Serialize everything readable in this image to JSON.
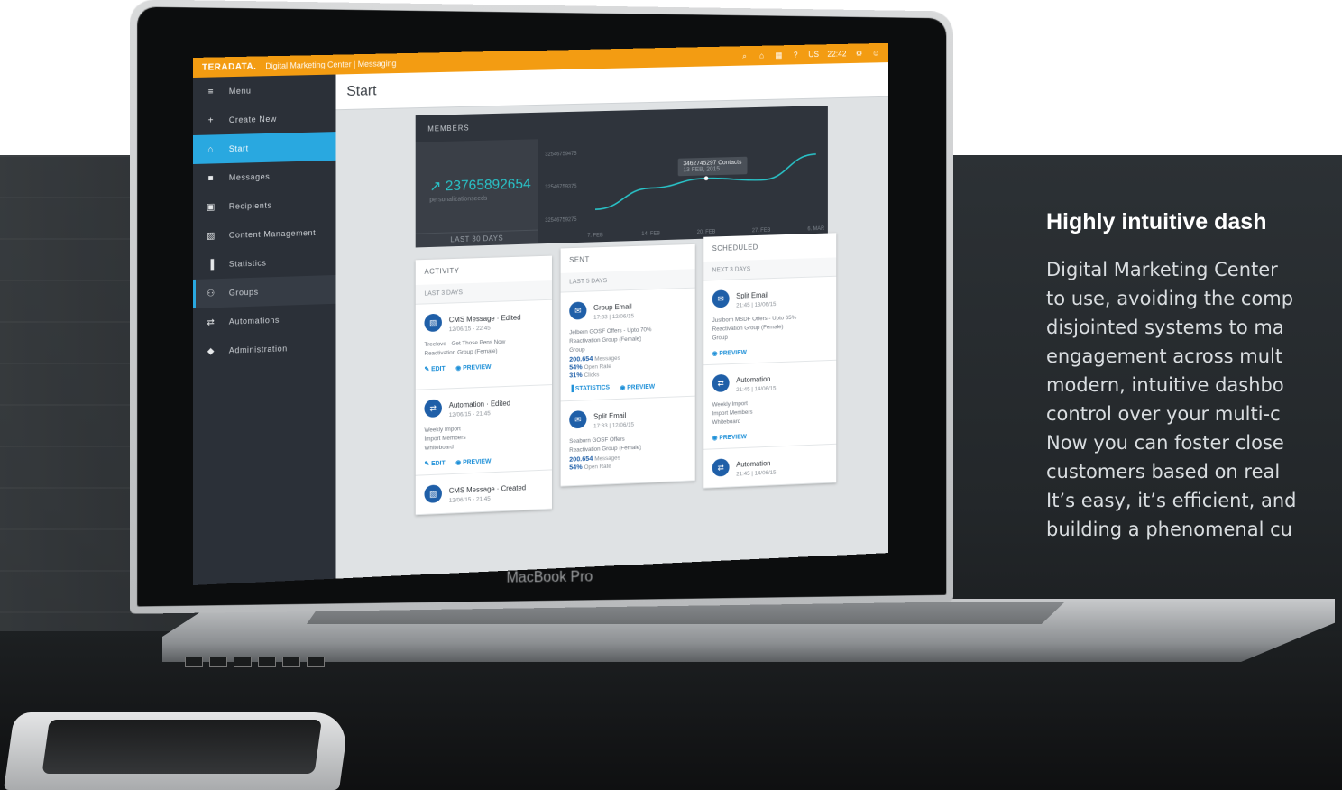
{
  "promo": {
    "heading": "Highly intuitive dash",
    "lines": [
      "Digital Marketing Center",
      "to use, avoiding the comp",
      "disjointed systems to ma",
      "engagement across mult",
      "modern, intuitive dashbo",
      "control over your multi-c",
      "Now you can foster close",
      "customers based on real",
      "It’s easy, it’s efficient, and",
      "building a phenomenal cu"
    ]
  },
  "laptop": {
    "label": "MacBook Pro"
  },
  "app": {
    "brand": "TERADATA.",
    "title": "Digital Marketing Center | Messaging",
    "top_right": {
      "region": "US",
      "time": "22:42"
    },
    "sidebar": [
      {
        "label": "Menu",
        "icon": "menu-icon"
      },
      {
        "label": "Create New",
        "icon": "plus-icon"
      },
      {
        "label": "Start",
        "icon": "home-icon"
      },
      {
        "label": "Messages",
        "icon": "messages-icon"
      },
      {
        "label": "Recipients",
        "icon": "recipients-icon"
      },
      {
        "label": "Content Management",
        "icon": "image-icon"
      },
      {
        "label": "Statistics",
        "icon": "bar-chart-icon"
      },
      {
        "label": "Groups",
        "icon": "group-icon"
      },
      {
        "label": "Automations",
        "icon": "repeat-icon"
      },
      {
        "label": "Administration",
        "icon": "shield-icon"
      }
    ],
    "page_title": "Start",
    "members": {
      "header": "MEMBERS",
      "total": "23765892654",
      "sub": "personalizationseeds",
      "range": "LAST 30 DAYS",
      "tooltip_value": "3462745297 Contacts",
      "tooltip_date": "13 FEB, 2015"
    },
    "activity": {
      "title": "ACTIVITY",
      "range": "LAST 3 DAYS",
      "cards": [
        {
          "title": "CMS Message · Edited",
          "time": "12/06/15 - 22:45",
          "line1": "Treelove - Get Those Pens Now",
          "line2": "Reactivation Group (Female)",
          "a1": "EDIT",
          "a2": "PREVIEW"
        },
        {
          "title": "Automation · Edited",
          "time": "12/06/15 - 21:45",
          "line1": "Weekly Import",
          "line2": "Import Members",
          "line3": "Whiteboard",
          "a1": "EDIT",
          "a2": "PREVIEW"
        },
        {
          "title": "CMS Message · Created",
          "time": "12/06/15 - 21:45"
        }
      ]
    },
    "sent": {
      "title": "SENT",
      "range": "LAST 5 DAYS",
      "cards": [
        {
          "title": "Group Email",
          "time": "17:33 | 12/06/15",
          "line1": "Jelbern GOSF Offers - Upto 70%",
          "line2": "Reactivation Group (Female)",
          "line3": "Group",
          "m1": "200.654",
          "m1l": "Messages",
          "m2": "54%",
          "m2l": "Open Rate",
          "m3": "31%",
          "m3l": "Clicks",
          "a1": "STATISTICS",
          "a2": "PREVIEW"
        },
        {
          "title": "Split Email",
          "time": "17:33 | 12/06/15",
          "line1": "Seaborn GOSF Offers",
          "line2": "Reactivation Group (Female)",
          "m1": "200.654",
          "m1l": "Messages",
          "m2": "54%",
          "m2l": "Open Rate"
        }
      ]
    },
    "scheduled": {
      "title": "SCHEDULED",
      "range": "NEXT 3 DAYS",
      "cards": [
        {
          "title": "Split Email",
          "time": "21:45 | 13/06/15",
          "line1": "Justborn MSDF Offers - Upto 65%",
          "line2": "Reactivation Group (Female)",
          "line3": "Group",
          "a1": "PREVIEW"
        },
        {
          "title": "Automation",
          "time": "21:45 | 14/06/15",
          "line1": "Weekly Import",
          "line2": "Import Members",
          "line3": "Whiteboard",
          "a1": "PREVIEW"
        },
        {
          "title": "Automation",
          "time": "21:45 | 14/06/15"
        }
      ]
    }
  },
  "chart_data": {
    "type": "line",
    "title": "",
    "xlabel": "",
    "ylabel": "",
    "categories": [
      "7. FEB",
      "14. FEB",
      "20. FEB",
      "27. FEB",
      "6. MAR"
    ],
    "y_ticks": [
      "32546759475",
      "32546759375",
      "32546759275"
    ],
    "series": [
      {
        "values": [
          32546759300,
          32546759360,
          32546759385,
          32546759375,
          32546759450
        ]
      }
    ]
  }
}
